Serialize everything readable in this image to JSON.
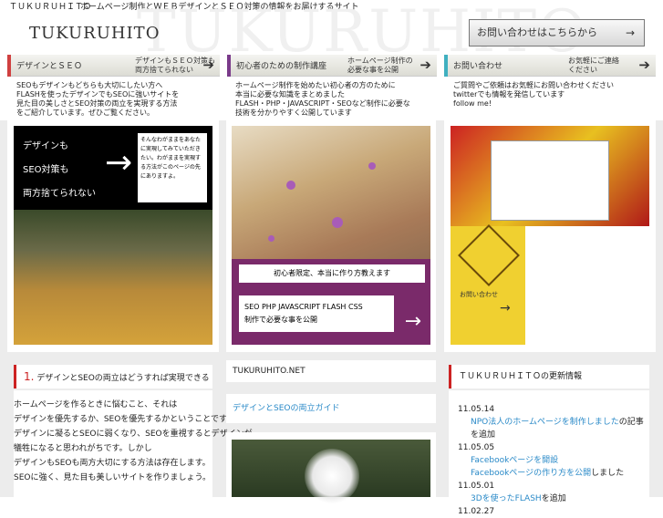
{
  "topbar": {
    "site_label": "ＴＵＫＵＲＵＨＩＴＯ",
    "tagline": "ホームページ制作とＷＥＢデザインとＳＥＯ対策の情報をお届けするサイト"
  },
  "header": {
    "watermark": "TUKURUHITO",
    "logo": "TUKURUHITO",
    "contact_button": "お問い合わせはこちらから",
    "contact_arrow": "→"
  },
  "tabs": [
    {
      "title": "デザインとＳＥＯ",
      "sub1": "デザインもＳＥＯ対策も",
      "sub2": "両方捨てられない",
      "accent": "#d04040"
    },
    {
      "title": "初心者のための制作講座",
      "sub1": "ホームページ制作の",
      "sub2": "必要な事を公開",
      "accent": "#7a3a8a"
    },
    {
      "title": "お問い合わせ",
      "sub1": "お気軽にご連絡",
      "sub2": "ください",
      "accent": "#40b0c0"
    }
  ],
  "descriptions": [
    [
      "SEOもデザインもどちらも大切にしたい方へ",
      "FLASHを使ったデザインでもSEOに強いサイトを",
      "見た目の美しさとSEO対策の両立を実現する方法",
      "をご紹介しています。ぜひご覧ください。"
    ],
    [
      "ホームページ制作を始めたい初心者の方のために",
      "本当に必要な知識をまとめました",
      "FLASH・PHP・JAVASCRIPT・SEOなど制作に必要な",
      "技術を分かりやすく公開しています"
    ],
    [
      "ご質問やご依頼はお気軽にお問い合わせください",
      "twitterでも情報を発信しています",
      "follow me!"
    ]
  ],
  "banner1": {
    "line1": "デザインも",
    "line2": "SEO対策も",
    "line3": "両方捨てられない",
    "arrow": "→",
    "note": "そんなわがままをあなたに実現してみていただきたい。わがままを実現する方法がこのページの先にありますよ。"
  },
  "banner2": {
    "box1": "初心者限定、本当に作り方教えます",
    "box2_line1": "SEO PHP JAVASCRIPT FLASH CSS",
    "box2_line2": "制作で必要な事を公開",
    "arrow": "→"
  },
  "banner3": {
    "contact_label": "お問い合わせ",
    "arrow": "→"
  },
  "article": {
    "num": "1.",
    "heading": "デザインとSEOの両立はどうすれば実現できるのか",
    "paragraphs": [
      "ホームページを作るときに悩むこと、それは",
      "デザインを優先するか、SEOを優先するかということです。",
      "デザインに凝るとSEOに弱くなり、SEOを重視するとデザインが",
      "犠牲になると思われがちです。しかし",
      "デザインもSEOも両方大切にする方法は存在します。",
      "SEOに強く、見た目も美しいサイトを作りましょう。"
    ]
  },
  "middle": {
    "site_title": "TUKURUHITO.NET",
    "link_text": "デザインとSEOの両立ガイド"
  },
  "news": {
    "heading": "ＴＵＫＵＲＵＨＩＴＯの更新情報",
    "items": [
      {
        "date": "11.05.14",
        "link": "NPO法人のホームページを制作しました",
        "rest": "の記事を追加"
      },
      {
        "date": "11.05.05",
        "link": "Facebookページを開設",
        "rest": ""
      },
      {
        "date": "",
        "link": "Facebookページの作り方を公開",
        "rest": "しました"
      },
      {
        "date": "11.05.01",
        "link": "3Dを使ったFLASH",
        "rest": "を追加"
      },
      {
        "date": "11.02.27",
        "link": "",
        "rest": ""
      }
    ]
  }
}
